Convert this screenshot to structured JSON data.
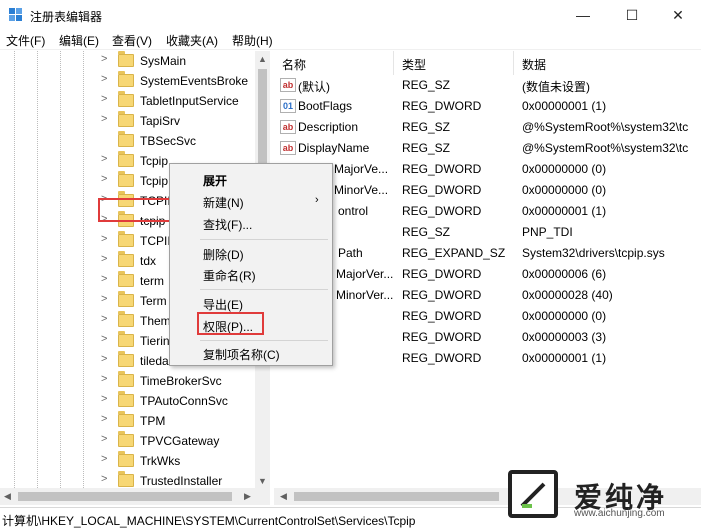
{
  "window": {
    "title": "注册表编辑器",
    "minimize": "—",
    "maximize": "☐",
    "close": "✕"
  },
  "menu": [
    "文件(F)",
    "编辑(E)",
    "查看(V)",
    "收藏夹(A)",
    "帮助(H)"
  ],
  "tree": {
    "items": [
      {
        "label": "SysMain",
        "expander": ">"
      },
      {
        "label": "SystemEventsBroke",
        "expander": ">"
      },
      {
        "label": "TabletInputService",
        "expander": ">"
      },
      {
        "label": "TapiSrv",
        "expander": ">"
      },
      {
        "label": "TBSecSvc",
        "expander": ""
      },
      {
        "label": "Tcpip",
        "expander": ">"
      },
      {
        "label": "Tcpip",
        "expander": ">"
      },
      {
        "label": "TCPII",
        "expander": ">"
      },
      {
        "label": "tcpip",
        "expander": ">"
      },
      {
        "label": "TCPII",
        "expander": ">"
      },
      {
        "label": "tdx",
        "expander": ">"
      },
      {
        "label": "term",
        "expander": ">"
      },
      {
        "label": "Term",
        "expander": ">"
      },
      {
        "label": "Them",
        "expander": ">"
      },
      {
        "label": "Tierin",
        "expander": ">"
      },
      {
        "label": "tiledа",
        "expander": ">"
      },
      {
        "label": "TimeBrokerSvc",
        "expander": ">"
      },
      {
        "label": "TPAutoConnSvc",
        "expander": ">"
      },
      {
        "label": "TPM",
        "expander": ">"
      },
      {
        "label": "TPVCGateway",
        "expander": ">"
      },
      {
        "label": "TrkWks",
        "expander": ">"
      },
      {
        "label": "TrustedInstaller",
        "expander": ">"
      }
    ]
  },
  "columns": {
    "name": "名称",
    "type": "类型",
    "data": "数据"
  },
  "values": [
    {
      "name": "(默认)",
      "type": "REG_SZ",
      "data": "(数值未设置)",
      "icon": "ab"
    },
    {
      "name": "BootFlags",
      "type": "REG_DWORD",
      "data": "0x00000001 (1)",
      "icon": "bin"
    },
    {
      "name": "Description",
      "type": "REG_SZ",
      "data": "@%SystemRoot%\\system32\\tc",
      "icon": "ab"
    },
    {
      "name": "DisplayName",
      "type": "REG_SZ",
      "data": "@%SystemRoot%\\system32\\tc",
      "icon": "ab"
    },
    {
      "name": "MajorVe...",
      "type": "REG_DWORD",
      "data": "0x00000000 (0)",
      "icon": "bin"
    },
    {
      "name": "MinorVe...",
      "type": "REG_DWORD",
      "data": "0x00000000 (0)",
      "icon": "bin"
    },
    {
      "name": "ontrol",
      "type": "REG_DWORD",
      "data": "0x00000001 (1)",
      "icon": "bin"
    },
    {
      "name": "",
      "type": "REG_SZ",
      "data": "PNP_TDI",
      "icon": "ab"
    },
    {
      "name": "Path",
      "type": "REG_EXPAND_SZ",
      "data": "System32\\drivers\\tcpip.sys",
      "icon": "ab"
    },
    {
      "name": "MajorVer...",
      "type": "REG_DWORD",
      "data": "0x00000006 (6)",
      "icon": "bin"
    },
    {
      "name": "MinorVer...",
      "type": "REG_DWORD",
      "data": "0x00000028 (40)",
      "icon": "bin"
    },
    {
      "name": "",
      "type": "REG_DWORD",
      "data": "0x00000000 (0)",
      "icon": "bin"
    },
    {
      "name": "",
      "type": "REG_DWORD",
      "data": "0x00000003 (3)",
      "icon": "bin"
    },
    {
      "name": "",
      "type": "REG_DWORD",
      "data": "0x00000001 (1)",
      "icon": "bin"
    }
  ],
  "context_menu": {
    "expand": "展开",
    "new": "新建(N)",
    "new_arrow": "›",
    "find": "查找(F)...",
    "delete": "删除(D)",
    "rename": "重命名(R)",
    "export": "导出(E)",
    "permissions": "权限(P)...",
    "copy_key_name": "复制项名称(C)"
  },
  "status": {
    "path": "计算机\\HKEY_LOCAL_MACHINE\\SYSTEM\\CurrentControlSet\\Services\\Tcpip"
  },
  "watermark": {
    "brand": "爱纯净",
    "url": "www.aichunjing.com"
  }
}
